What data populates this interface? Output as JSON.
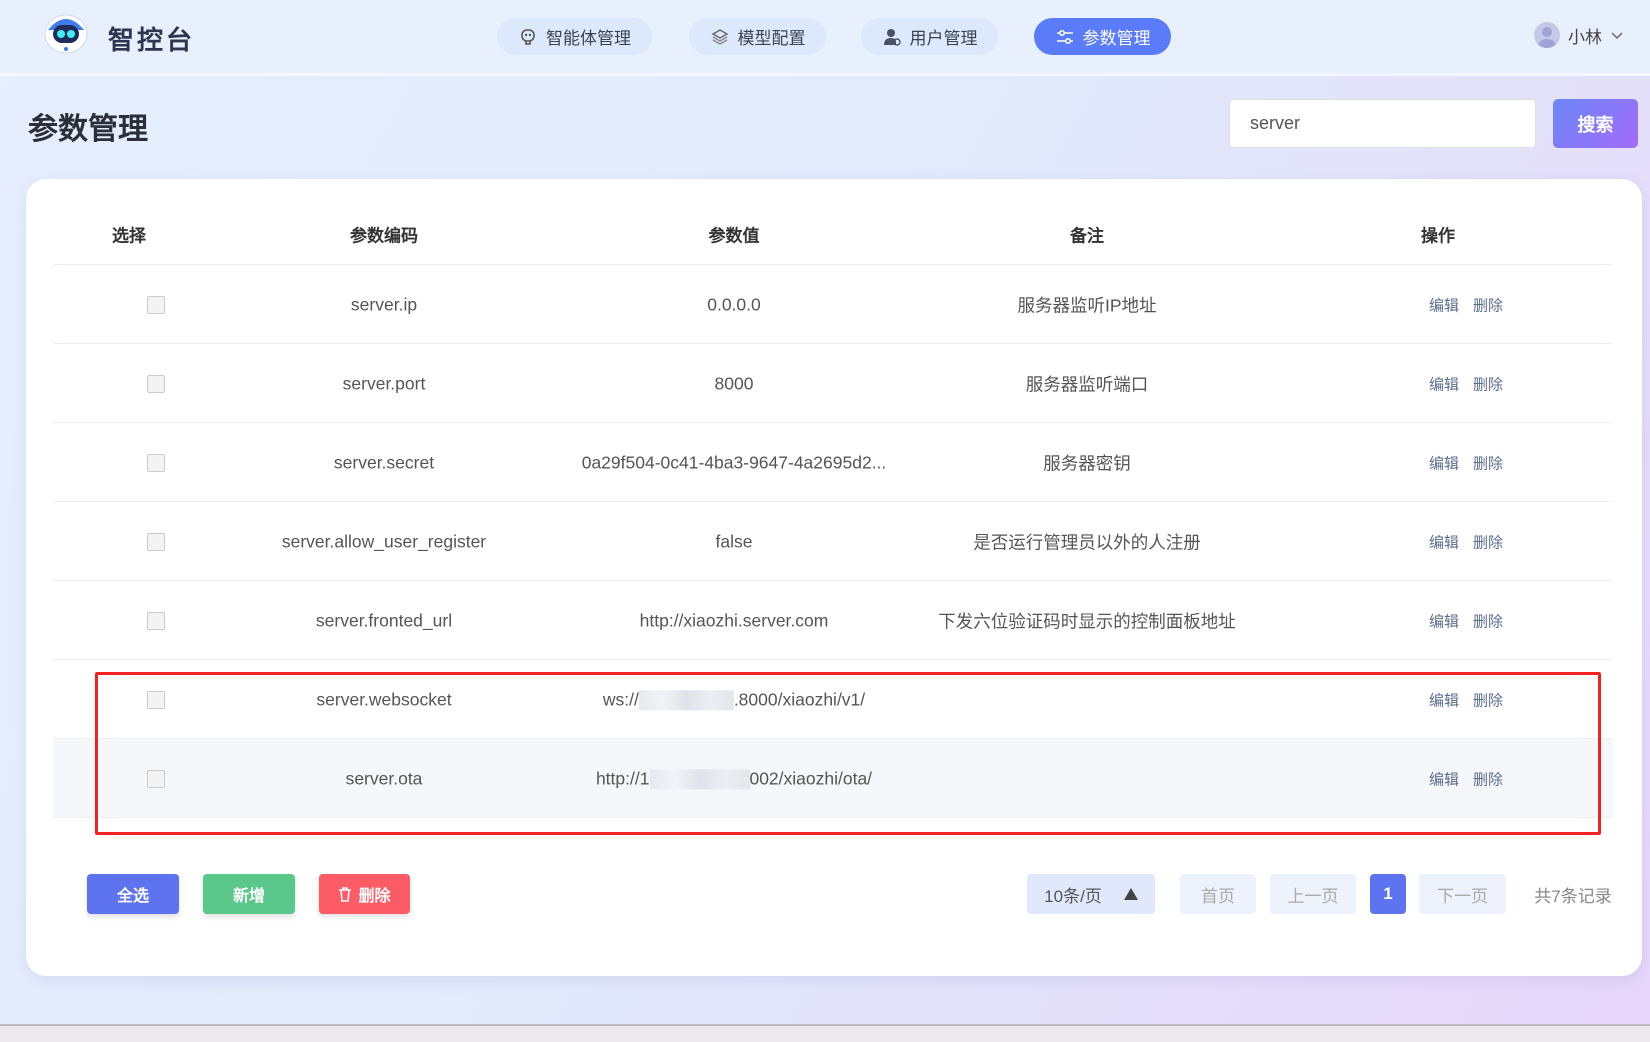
{
  "header": {
    "brand": "智控台",
    "nav": [
      {
        "label": "智能体管理",
        "icon": "robot-icon",
        "active": false
      },
      {
        "label": "模型配置",
        "icon": "layers-icon",
        "active": false
      },
      {
        "label": "用户管理",
        "icon": "user-icon",
        "active": false
      },
      {
        "label": "参数管理",
        "icon": "sliders-icon",
        "active": true
      }
    ],
    "user": "小林"
  },
  "page": {
    "title": "参数管理",
    "search_value": "server",
    "search_label": "搜索"
  },
  "table": {
    "columns": [
      "选择",
      "参数编码",
      "参数值",
      "备注",
      "操作"
    ],
    "rows": [
      {
        "code": "server.ip",
        "value": "0.0.0.0",
        "remark": "服务器监听IP地址"
      },
      {
        "code": "server.port",
        "value": "8000",
        "remark": "服务器监听端口"
      },
      {
        "code": "server.secret",
        "value": "0a29f504-0c41-4ba3-9647-4a2695d2...",
        "remark": "服务器密钥"
      },
      {
        "code": "server.allow_user_register",
        "value": "false",
        "remark": "是否运行管理员以外的人注册"
      },
      {
        "code": "server.fronted_url",
        "value": "http://xiaozhi.server.com",
        "remark": "下发六位验证码时显示的控制面板地址"
      },
      {
        "code": "server.websocket",
        "value_prefix": "ws://",
        "value_suffix": ".8000/xiaozhi/v1/",
        "remark": ""
      },
      {
        "code": "server.ota",
        "value_prefix": "http://1",
        "value_suffix": "002/xiaozhi/ota/",
        "remark": ""
      }
    ],
    "edit_label": "编辑",
    "delete_label": "删除"
  },
  "footer": {
    "select_all": "全选",
    "add": "新增",
    "delete": "删除",
    "page_size": "10条/页",
    "first": "首页",
    "prev": "上一页",
    "current": "1",
    "next": "下一页",
    "total": "共7条记录"
  },
  "colors": {
    "accent": "#5b7cfa",
    "green": "#5ac88a",
    "red": "#fd5b66",
    "highlight": "#f02424"
  }
}
